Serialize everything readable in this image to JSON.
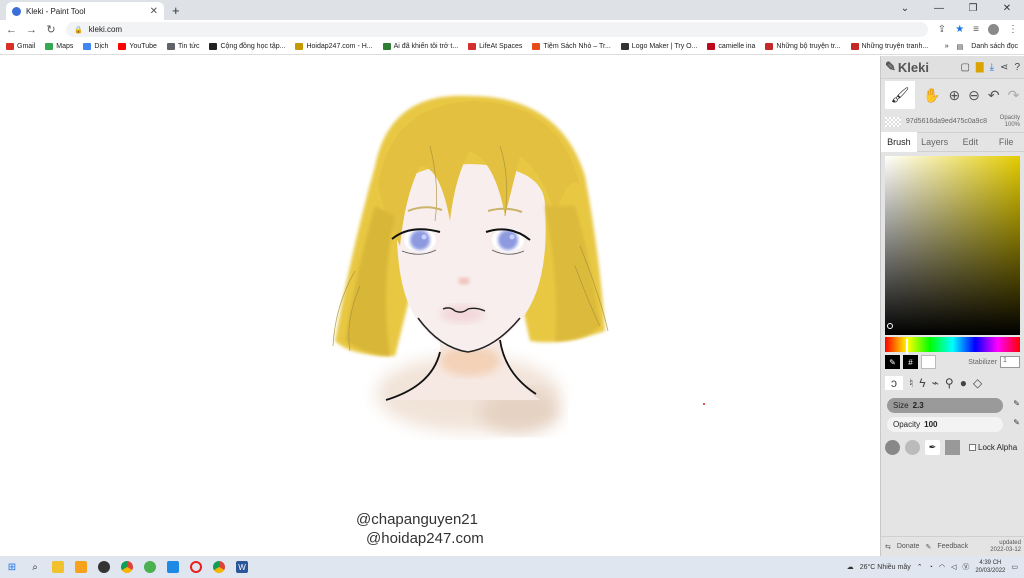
{
  "browser": {
    "tab_title": "Kleki - Paint Tool",
    "url": "kleki.com",
    "bookmarks": [
      {
        "label": "Gmail",
        "color": "#d93025"
      },
      {
        "label": "Maps",
        "color": "#34a853"
      },
      {
        "label": "Dịch",
        "color": "#4285f4"
      },
      {
        "label": "YouTube",
        "color": "#ff0000"
      },
      {
        "label": "Tin tức",
        "color": "#5f6368"
      },
      {
        "label": "Cộng đồng học tập...",
        "color": "#222222"
      },
      {
        "label": "Hoidap247.com - H...",
        "color": "#c49a00"
      },
      {
        "label": "Ai đã khiến tôi trở t...",
        "color": "#2e7d32"
      },
      {
        "label": "LifeAt Spaces",
        "color": "#d32f2f"
      },
      {
        "label": "Tiệm Sách Nhỏ – Tr...",
        "color": "#e64a19"
      },
      {
        "label": "Logo Maker | Try O...",
        "color": "#333333"
      },
      {
        "label": "camielle ina",
        "color": "#bd081c"
      },
      {
        "label": "Những bộ truyện tr...",
        "color": "#c62828"
      },
      {
        "label": "Những truyện tranh...",
        "color": "#c62828"
      }
    ],
    "reading_list": "Danh sách đọc"
  },
  "canvas": {
    "watermark_line1": "@chapanguyen21",
    "watermark_line2": "@hoidap247.com"
  },
  "kleki": {
    "logo": "Kleki",
    "color_hex": "97d5616da9ed475c0a9c8",
    "opacity_label": "Opacity",
    "opacity_value": "100%",
    "tabs": [
      "Brush",
      "Layers",
      "Edit",
      "File"
    ],
    "hash_glyph": "#",
    "stabilizer_label": "Stabilizer",
    "stabilizer_value": "1",
    "size_label": "Size",
    "size_value": "2.3",
    "brush_opacity_label": "Opacity",
    "brush_opacity_value": "100",
    "lock_alpha": "Lock Alpha",
    "donate": "Donate",
    "feedback": "Feedback",
    "updated_label": "updated",
    "updated_date": "2022-03-12",
    "primary_color": "#e4cc00"
  },
  "taskbar": {
    "weather": "26°C Nhiều mây",
    "time": "4:39 CH",
    "date": "20/03/2022"
  }
}
